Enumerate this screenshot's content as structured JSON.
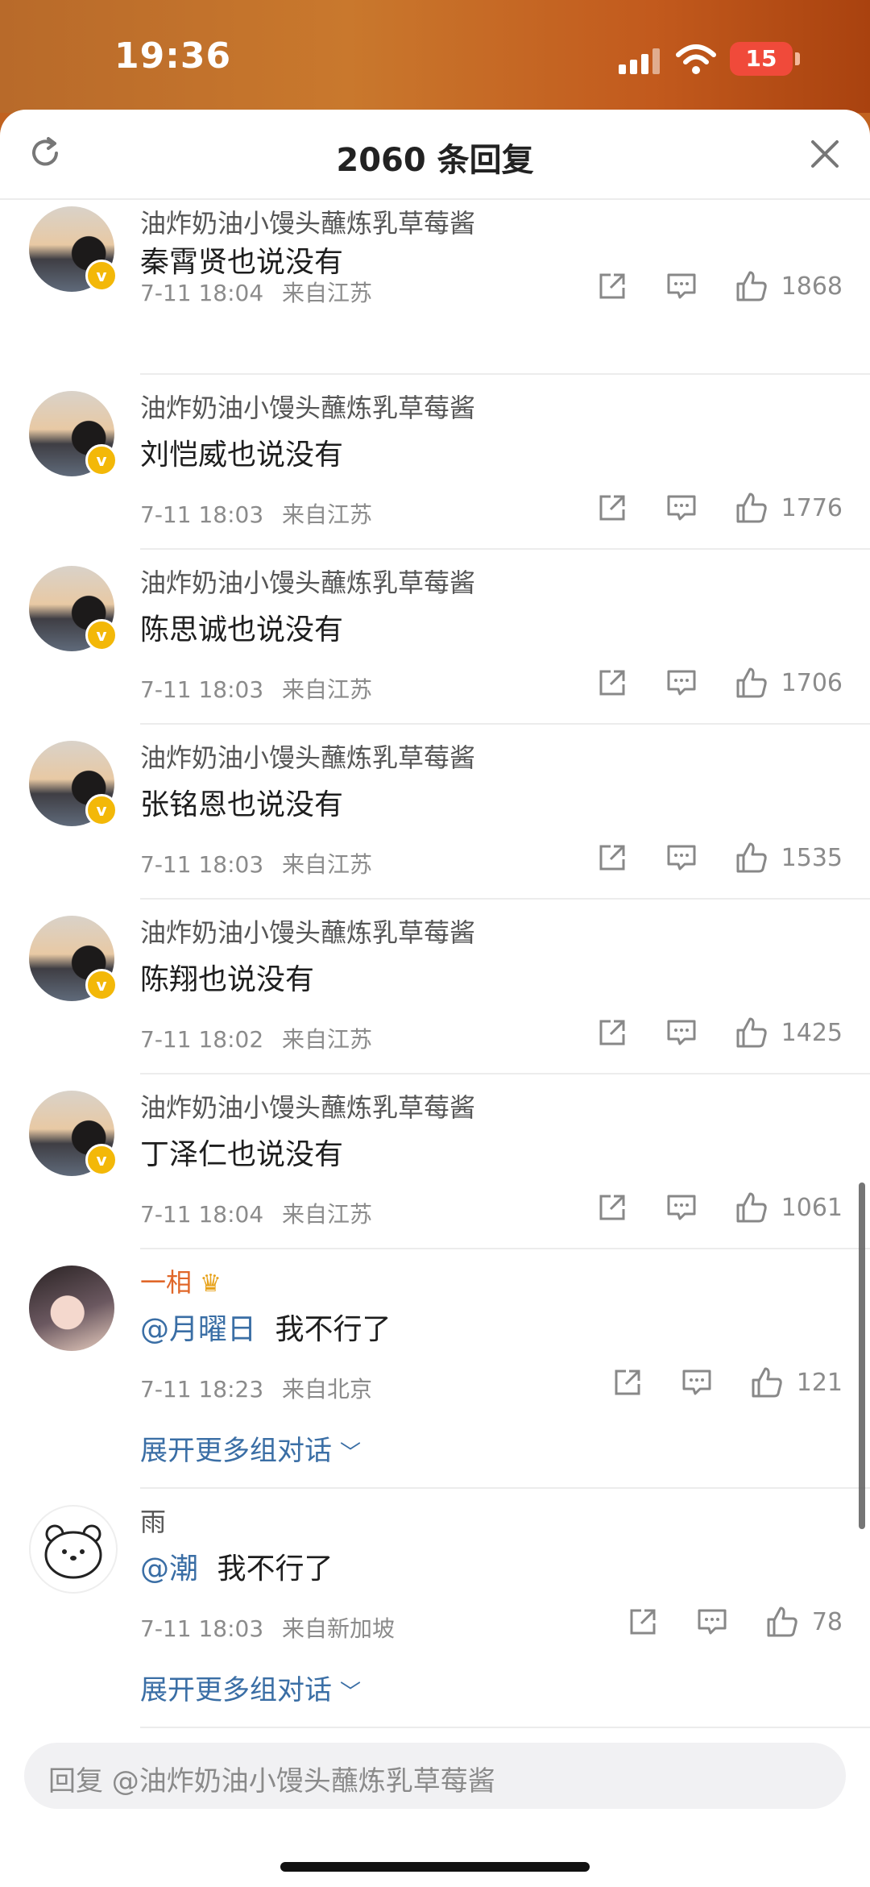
{
  "status": {
    "time": "19:36",
    "battery": "15"
  },
  "header": {
    "title": "2060 条回复"
  },
  "comments": [
    {
      "user": "油炸奶油小馒头蘸炼乳草莓酱",
      "text": "秦霄贤也说没有",
      "date": "7-11 18:04",
      "location": "来自江苏",
      "likes": "1868"
    },
    {
      "user": "油炸奶油小馒头蘸炼乳草莓酱",
      "text": "刘恺威也说没有",
      "date": "7-11 18:03",
      "location": "来自江苏",
      "likes": "1776"
    },
    {
      "user": "油炸奶油小馒头蘸炼乳草莓酱",
      "text": "陈思诚也说没有",
      "date": "7-11 18:03",
      "location": "来自江苏",
      "likes": "1706"
    },
    {
      "user": "油炸奶油小馒头蘸炼乳草莓酱",
      "text": "张铭恩也说没有",
      "date": "7-11 18:03",
      "location": "来自江苏",
      "likes": "1535"
    },
    {
      "user": "油炸奶油小馒头蘸炼乳草莓酱",
      "text": "陈翔也说没有",
      "date": "7-11 18:02",
      "location": "来自江苏",
      "likes": "1425"
    },
    {
      "user": "油炸奶油小馒头蘸炼乳草莓酱",
      "text": "丁泽仁也说没有",
      "date": "7-11 18:04",
      "location": "来自江苏",
      "likes": "1061"
    },
    {
      "user": "一相",
      "mention": "@月曜日",
      "text": "我不行了",
      "date": "7-11 18:23",
      "location": "来自北京",
      "likes": "121",
      "more": "展开更多组对话"
    },
    {
      "user": "雨",
      "mention": "@潮",
      "text": "我不行了",
      "date": "7-11 18:03",
      "location": "来自新加坡",
      "likes": "78",
      "more": "展开更多组对话"
    }
  ],
  "reply_bar": {
    "placeholder": "回复 @油炸奶油小馒头蘸炼乳草莓酱"
  }
}
